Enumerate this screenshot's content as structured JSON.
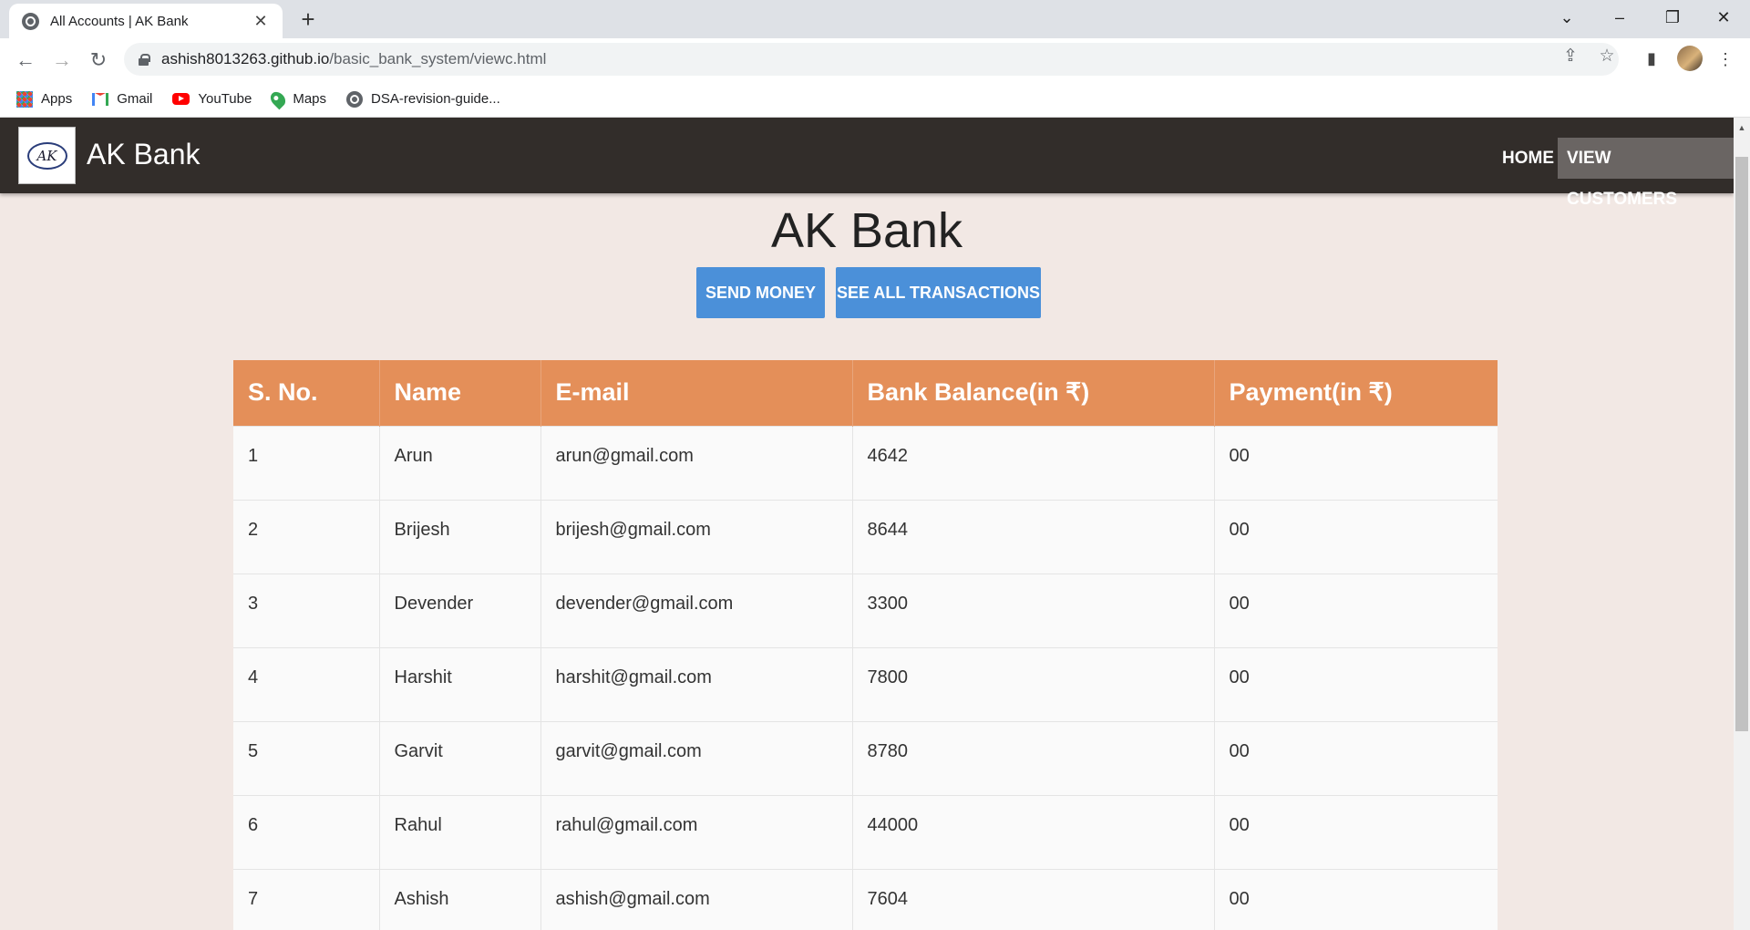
{
  "browser": {
    "tab_title": "All Accounts | AK Bank",
    "url_host": "ashish8013263.github.io",
    "url_path": "/basic_bank_system/viewc.html",
    "bookmarks": [
      {
        "label": "Apps"
      },
      {
        "label": "Gmail"
      },
      {
        "label": "YouTube"
      },
      {
        "label": "Maps"
      },
      {
        "label": "DSA-revision-guide..."
      }
    ]
  },
  "nav": {
    "brand": "AK Bank",
    "logo_text": "AK",
    "links": [
      "HOME",
      "VIEW CUSTOMERS"
    ]
  },
  "main": {
    "title": "AK Bank",
    "buttons": [
      "SEND MONEY",
      "SEE ALL TRANSACTIONS"
    ]
  },
  "table": {
    "headers": [
      "S. No.",
      "Name",
      "E-mail",
      "Bank Balance(in ₹)",
      "Payment(in ₹)"
    ],
    "rows": [
      [
        "1",
        "Arun",
        "arun@gmail.com",
        "4642",
        "00"
      ],
      [
        "2",
        "Brijesh",
        "brijesh@gmail.com",
        "8644",
        "00"
      ],
      [
        "3",
        "Devender",
        "devender@gmail.com",
        "3300",
        "00"
      ],
      [
        "4",
        "Harshit",
        "harshit@gmail.com",
        "7800",
        "00"
      ],
      [
        "5",
        "Garvit",
        "garvit@gmail.com",
        "8780",
        "00"
      ],
      [
        "6",
        "Rahul",
        "rahul@gmail.com",
        "44000",
        "00"
      ],
      [
        "7",
        "Ashish",
        "ashish@gmail.com",
        "7604",
        "00"
      ]
    ]
  },
  "colors": {
    "navbar": "#322d2a",
    "table_header": "#e48f59",
    "button": "#4b90d9",
    "page_bg": "#f2e8e4"
  }
}
